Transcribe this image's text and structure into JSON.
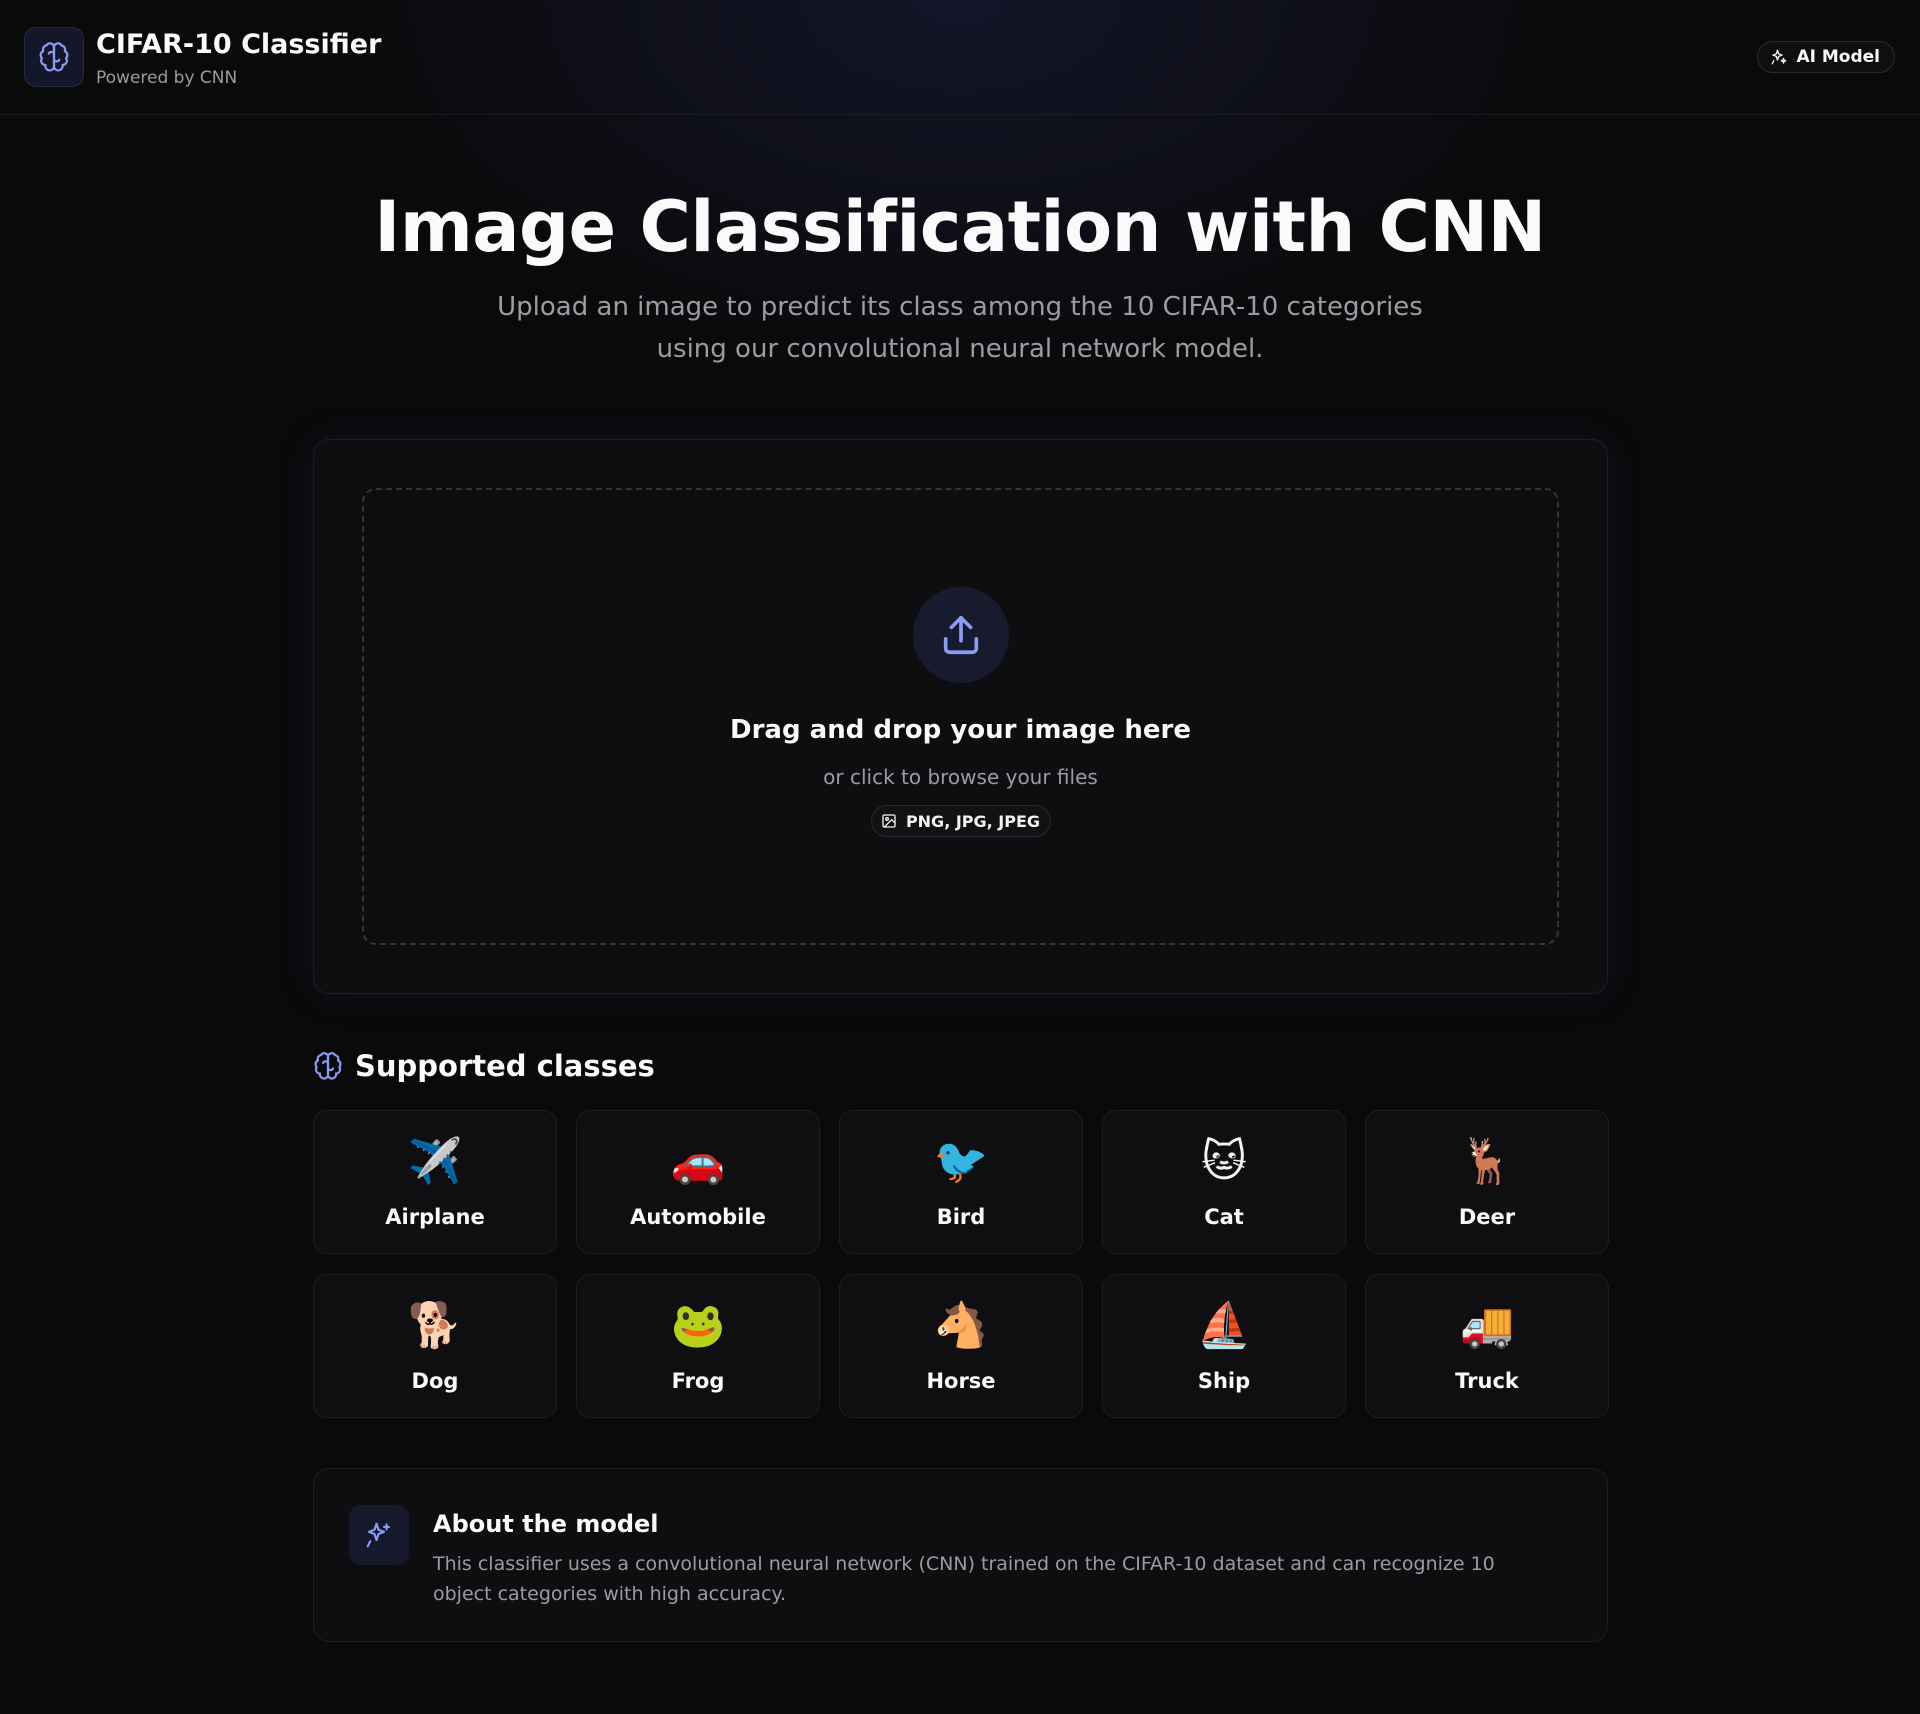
{
  "header": {
    "title": "CIFAR-10 Classifier",
    "subtitle": "Powered by CNN",
    "badge": "AI Model",
    "logo_icon": "brain-icon",
    "badge_icon": "sparkles-icon"
  },
  "hero": {
    "title": "Image Classification with CNN",
    "subtitle": "Upload an image to predict its class among the 10 CIFAR-10 categories using our convolutional neural network model."
  },
  "upload": {
    "icon": "upload-icon",
    "title": "Drag and drop your image here",
    "subtitle": "or click to browse your files",
    "formats": "PNG, JPG, JPEG",
    "formats_icon": "image-icon"
  },
  "classes": {
    "title": "Supported classes",
    "icon": "brain-icon",
    "items": [
      {
        "label": "Airplane",
        "emoji": "✈️"
      },
      {
        "label": "Automobile",
        "emoji": "🚗"
      },
      {
        "label": "Bird",
        "emoji": "🐦"
      },
      {
        "label": "Cat",
        "emoji": "🐱"
      },
      {
        "label": "Deer",
        "emoji": "🦌"
      },
      {
        "label": "Dog",
        "emoji": "🐕"
      },
      {
        "label": "Frog",
        "emoji": "🐸"
      },
      {
        "label": "Horse",
        "emoji": "🐴"
      },
      {
        "label": "Ship",
        "emoji": "⛵"
      },
      {
        "label": "Truck",
        "emoji": "🚚"
      }
    ]
  },
  "about": {
    "title": "About the model",
    "text": "This classifier uses a convolutional neural network (CNN) trained on the CIFAR-10 dataset and can recognize 10 object categories with high accuracy.",
    "icon": "sparkles-icon"
  },
  "colors": {
    "background": "#0a0a0b",
    "card": "#0e0e10",
    "accent": "#8b9cf7",
    "muted_text": "#9b9ba4"
  }
}
